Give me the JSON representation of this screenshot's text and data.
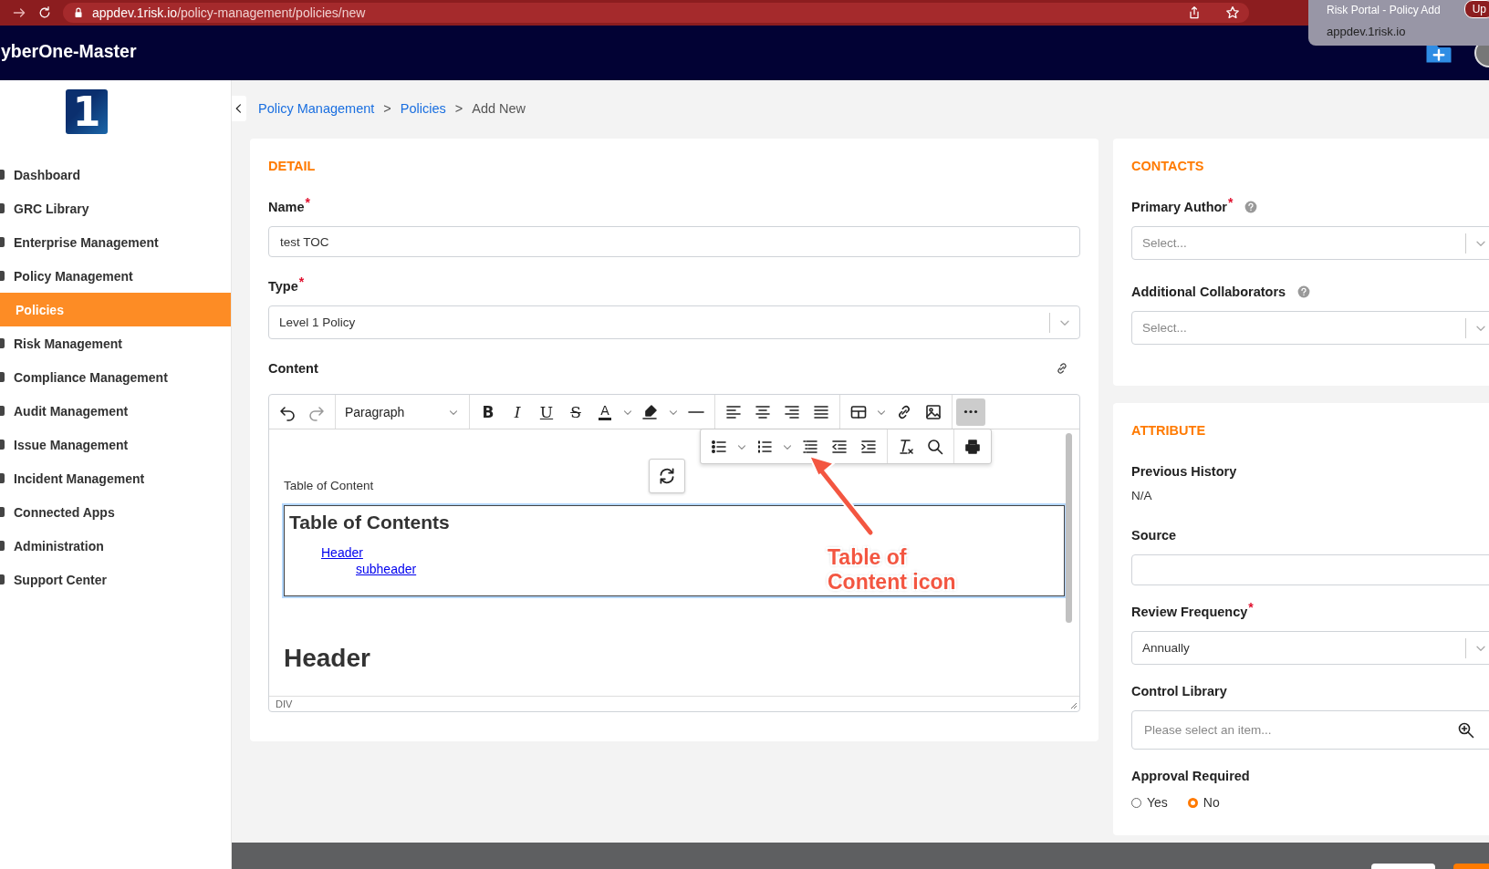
{
  "browser": {
    "url_host": "appdev.1risk.io",
    "url_path": "/policy-management/policies/new",
    "tooltip": {
      "title": "Risk Portal - Policy Add",
      "url": "appdev.1risk.io"
    },
    "update_button": "Up"
  },
  "app": {
    "title": "yberOne-Master"
  },
  "sidebar": {
    "logo_text": "1",
    "items": [
      {
        "label": "Dashboard",
        "selected": false
      },
      {
        "label": "GRC Library",
        "selected": false
      },
      {
        "label": "Enterprise Management",
        "selected": false
      },
      {
        "label": "Policy Management",
        "selected": false,
        "children": [
          {
            "label": "Policies",
            "selected": true
          }
        ]
      },
      {
        "label": "Risk Management",
        "selected": false
      },
      {
        "label": "Compliance Management",
        "selected": false
      },
      {
        "label": "Audit Management",
        "selected": false
      },
      {
        "label": "Issue Management",
        "selected": false
      },
      {
        "label": "Incident Management",
        "selected": false
      },
      {
        "label": "Connected Apps",
        "selected": false
      },
      {
        "label": "Administration",
        "selected": false
      },
      {
        "label": "Support Center",
        "selected": false
      }
    ]
  },
  "breadcrumb": {
    "items": [
      {
        "label": "Policy Management",
        "kind": "link"
      },
      {
        "label": "Policies",
        "kind": "link"
      },
      {
        "label": "Add New",
        "kind": "current"
      }
    ],
    "separators": [
      ">",
      ">"
    ]
  },
  "detail": {
    "heading": "DETAIL",
    "name": {
      "label": "Name",
      "required_mark": "*",
      "value": "test TOC"
    },
    "type": {
      "label": "Type",
      "required_mark": "*",
      "value": "Level 1 Policy"
    },
    "content": {
      "label": "Content",
      "editor": {
        "block_format": "Paragraph",
        "format_buttons": [
          {
            "kind": "bold",
            "text": "B"
          },
          {
            "kind": "italic",
            "text": "I"
          },
          {
            "kind": "underline",
            "text": "U"
          },
          {
            "kind": "strike",
            "text": "S"
          }
        ],
        "text_color_glyph": "A",
        "more_active": true,
        "body": {
          "intro": "Table of Content",
          "toc": {
            "title": "Table of Contents",
            "selected": true,
            "entries": [
              {
                "label": "Header",
                "children": [
                  {
                    "label": "subheader"
                  }
                ]
              }
            ]
          },
          "heading": "Header"
        },
        "status_path": "DIV"
      }
    }
  },
  "annotation": {
    "text": "Table of Content icon"
  },
  "contacts": {
    "heading": "CONTACTS",
    "fields": [
      {
        "label": "Primary Author",
        "required_mark": "*",
        "help": true,
        "placeholder": "Select..."
      },
      {
        "label": "Additional Collaborators",
        "help": true,
        "placeholder": "Select..."
      }
    ]
  },
  "attribute": {
    "heading": "ATTRIBUTE",
    "fields": [
      {
        "kind": "readonly",
        "label": "Previous History",
        "value": "N/A"
      },
      {
        "kind": "text",
        "label": "Source"
      },
      {
        "kind": "select",
        "label": "Review Frequency",
        "required_mark": "*",
        "value": "Annually"
      },
      {
        "kind": "lookup",
        "label": "Control Library",
        "placeholder": "Please select an item..."
      },
      {
        "kind": "radio",
        "label": "Approval Required",
        "options": [
          {
            "label": "Yes",
            "selected": false
          },
          {
            "label": "No",
            "selected": true
          }
        ]
      }
    ]
  }
}
